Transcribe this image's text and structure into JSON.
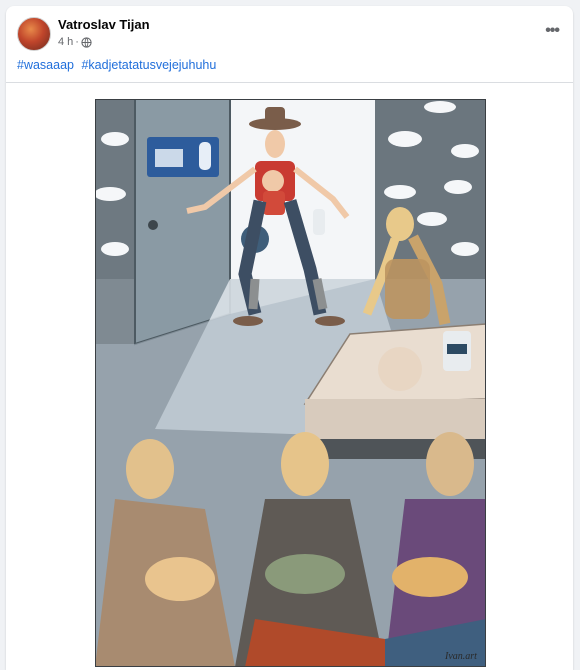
{
  "post": {
    "author": "Vatroslav Tijan",
    "time": "4 h",
    "separator": "·",
    "audience_icon": "globe-icon",
    "more_icon": "more-options-icon",
    "more_label": "•••",
    "hashtags": [
      "#wasaaap",
      "#kadjetatatusvejejuhuhu"
    ],
    "image": {
      "description_icon": "comic-illustration",
      "signature": "Ivan.art"
    }
  },
  "colors": {
    "link": "#216fdb",
    "secondary_text": "#65676b",
    "primary_text": "#050505"
  }
}
